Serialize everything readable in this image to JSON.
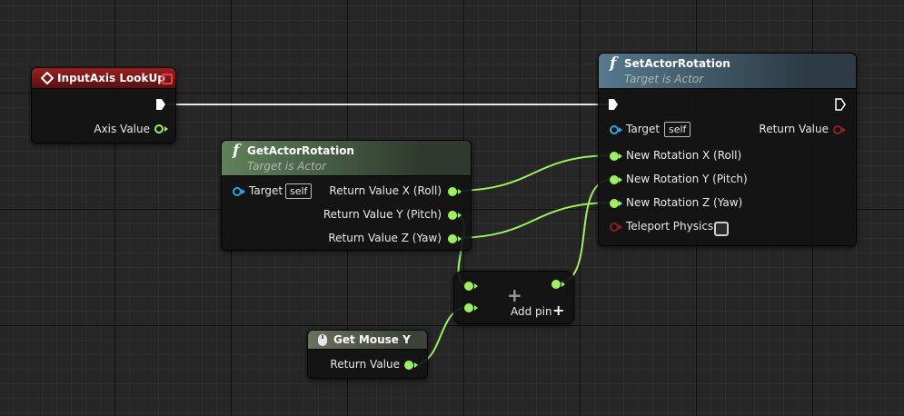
{
  "colors": {
    "event_header": "#8b1a1a",
    "pure_header": "#5b7b55",
    "function_header": "#4f7186",
    "mouse_header": "#5d6658",
    "float_pin": "#9bf25a",
    "object_pin": "#2fa5e6",
    "bool_pin": "#8f1e1e",
    "exec_wire": "#e8e8e8"
  },
  "input_axis": {
    "title": "InputAxis LookUp",
    "axis_value": "Axis Value"
  },
  "get_actor_rotation": {
    "title": "GetActorRotation",
    "subtitle": "Target is Actor",
    "target": "Target",
    "self": "self",
    "return_x": "Return Value X (Roll)",
    "return_y": "Return Value Y (Pitch)",
    "return_z": "Return Value Z (Yaw)"
  },
  "set_actor_rotation": {
    "title": "SetActorRotation",
    "subtitle": "Target is Actor",
    "target": "Target",
    "self": "self",
    "return_value": "Return Value",
    "new_x": "New Rotation X (Roll)",
    "new_y": "New Rotation Y (Pitch)",
    "new_z": "New Rotation Z (Yaw)",
    "teleport": "Teleport Physics"
  },
  "add_node": {
    "add_pin": "Add pin",
    "plus": "+"
  },
  "get_mouse_y": {
    "title": "Get Mouse Y",
    "return_value": "Return Value"
  }
}
